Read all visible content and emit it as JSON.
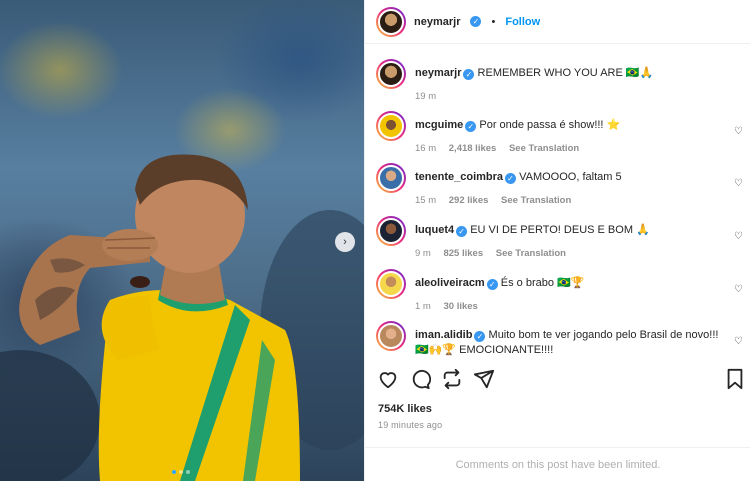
{
  "post": {
    "author": "neymarjr",
    "header_dot": "•",
    "follow_label": "Follow",
    "caption": {
      "username": "neymarjr",
      "text": "REMEMBER WHO YOU ARE 🇧🇷🙏",
      "time": "19 m"
    },
    "likes": "754K likes",
    "posted_ago": "19 minutes ago",
    "comments_limited": "Comments on this post have been limited."
  },
  "comments": [
    {
      "username": "mcguime",
      "text": "Por onde passa é show!!! ⭐",
      "time": "16 m",
      "likes": "2,418 likes",
      "translate": "See Translation"
    },
    {
      "username": "tenente_coimbra",
      "text": "VAMOOOO, faltam 5",
      "time": "15 m",
      "likes": "292 likes",
      "translate": "See Translation"
    },
    {
      "username": "luquet4",
      "text": "EU VI DE PERTO! DEUS E BOM 🙏",
      "time": "9 m",
      "likes": "825 likes",
      "translate": "See Translation"
    },
    {
      "username": "aleoliveiracm",
      "text": "És o brabo 🇧🇷🏆",
      "time": "1 m",
      "likes": "30 likes",
      "translate": ""
    },
    {
      "username": "iman.alidib",
      "text": "Muito bom te ver jogando pelo Brasil de novo!!! 🇧🇷🙌🏆 EMOCIONANTE!!!!",
      "time": "",
      "likes": "",
      "translate": ""
    }
  ],
  "icons": {
    "like": "heart-icon",
    "comment": "comment-icon",
    "share": "share-icon",
    "repost": "repost-icon",
    "save": "bookmark-icon",
    "next": "chevron-right-icon",
    "verified": "verified-badge-icon"
  },
  "colors": {
    "accent": "#0095f6",
    "verified": "#3897f0",
    "muted": "#8e8e8e",
    "jersey": "#f2c400",
    "jersey_stripe": "#1f9e6e"
  },
  "carousel": {
    "count": 3,
    "active": 1
  }
}
